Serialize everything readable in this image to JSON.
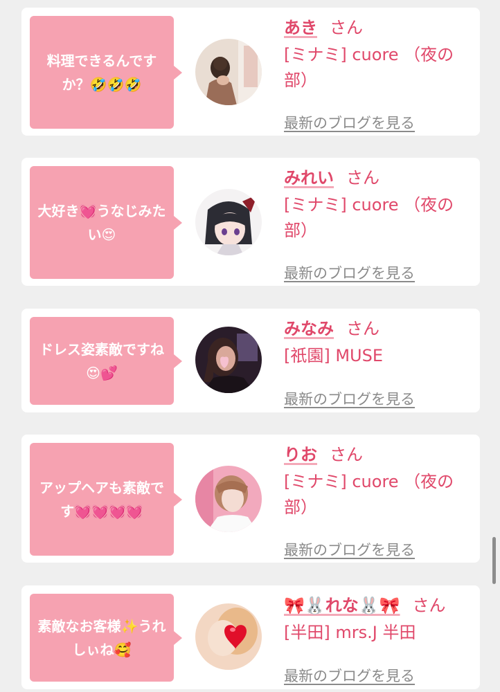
{
  "cards": [
    {
      "comment": "料理できるんですか？🤣🤣🤣",
      "name": "あき",
      "suffix": "さん",
      "shop": "[ミナミ] cuore （夜の部）",
      "blog_link": "最新のブログを見る",
      "avatar": "avatar-photo-woman-updo"
    },
    {
      "comment": "大好き💓うなじみたい😍",
      "name": "みれい",
      "suffix": "さん",
      "shop": "[ミナミ] cuore （夜の部）",
      "blog_link": "最新のブログを見る",
      "avatar": "avatar-anime-girl"
    },
    {
      "comment": "ドレス姿素敵ですね😍💕",
      "name": "みなみ",
      "suffix": "さん",
      "shop": "[祇園] MUSE",
      "blog_link": "最新のブログを見る",
      "avatar": "avatar-photo-woman-heart"
    },
    {
      "comment": "アップヘアも素敵です💓💓💓💓",
      "name": "りお",
      "suffix": "さん",
      "shop": "[ミナミ] cuore （夜の部）",
      "blog_link": "最新のブログを見る",
      "avatar": "avatar-photo-woman-pink"
    },
    {
      "comment": "素敵なお客様✨うれしぃね🥰",
      "name": "🎀🐰れな🐰🎀",
      "suffix": "さん",
      "shop": "[半田] mrs.J 半田",
      "blog_link": "最新のブログを見る",
      "avatar": "avatar-photo-red-heart"
    }
  ],
  "colors": {
    "accent": "#e0486a",
    "bubble": "#f6a2b1",
    "link_gray": "#8a8a8a",
    "background": "#efefef"
  }
}
